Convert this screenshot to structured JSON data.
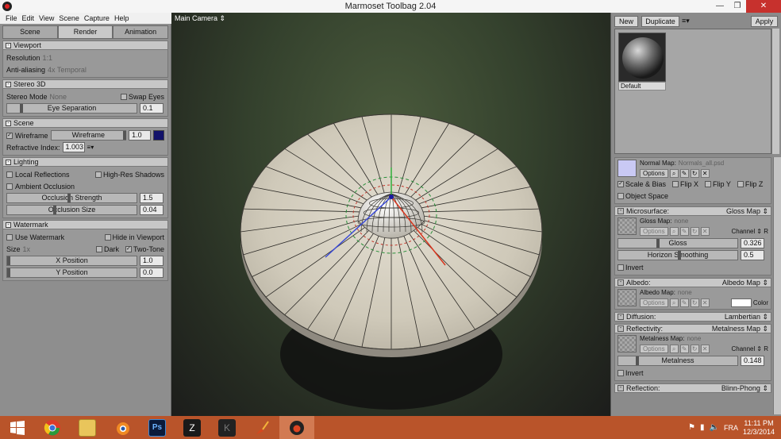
{
  "window": {
    "title": "Marmoset Toolbag 2.04"
  },
  "menu": [
    "File",
    "Edit",
    "View",
    "Scene",
    "Capture",
    "Help"
  ],
  "tabs": [
    "Scene",
    "Render",
    "Animation"
  ],
  "viewport_section": {
    "title": "Viewport",
    "resolution_label": "Resolution",
    "resolution_value": "1:1",
    "aa_label": "Anti-aliasing",
    "aa_value": "4x Temporal"
  },
  "stereo": {
    "title": "Stereo 3D",
    "mode_label": "Stereo Mode",
    "mode_value": "None",
    "swap_label": "Swap Eyes",
    "sep_label": "Eye Separation",
    "sep_value": "0.1"
  },
  "scene": {
    "title": "Scene",
    "wire_label": "Wireframe",
    "wire_slider": "Wireframe",
    "wire_value": "1.0",
    "refr_label": "Refractive Index:",
    "refr_value": "1.003"
  },
  "lighting": {
    "title": "Lighting",
    "local_refl": "Local Reflections",
    "hires": "High-Res Shadows",
    "ao": "Ambient Occlusion",
    "occ_strength": "Occlusion Strength",
    "occ_strength_value": "1.5",
    "occ_size": "Occlusion Size",
    "occ_size_value": "0.04"
  },
  "watermark": {
    "title": "Watermark",
    "use": "Use Watermark",
    "hide": "Hide in Viewport",
    "size_label": "Size",
    "size_value": "1x",
    "dark": "Dark",
    "twotone": "Two-Tone",
    "xpos": "X Position",
    "xpos_value": "1.0",
    "ypos": "Y Position",
    "ypos_value": "0.0"
  },
  "camera": {
    "label": "Main Camera"
  },
  "materials": {
    "new": "New",
    "duplicate": "Duplicate",
    "apply": "Apply",
    "default_name": "Default",
    "normal_map_label": "Normal Map:",
    "normal_map_file": "Normals_all.psd",
    "options": "Options",
    "scale_bias": "Scale & Bias",
    "flip_x": "Flip X",
    "flip_y": "Flip Y",
    "flip_z": "Flip Z",
    "object_space": "Object Space",
    "microsurface": "Microsurface:",
    "microsurface_mode": "Gloss Map",
    "gloss_map_label": "Gloss Map:",
    "gloss_map_value": "none",
    "channel": "Channel",
    "channel_value": "R",
    "gloss": "Gloss",
    "gloss_value": "0.326",
    "horizon": "Horizon Smoothing",
    "horizon_value": "0.5",
    "invert": "Invert",
    "albedo": "Albedo:",
    "albedo_mode": "Albedo Map",
    "albedo_map_label": "Albedo Map:",
    "albedo_map_value": "none",
    "color": "Color",
    "diffusion": "Diffusion:",
    "diffusion_mode": "Lambertian",
    "reflectivity": "Reflectivity:",
    "reflectivity_mode": "Metalness Map",
    "metal_map_label": "Metalness Map:",
    "metal_map_value": "none",
    "metalness": "Metalness",
    "metalness_value": "0.148",
    "reflection": "Reflection:",
    "reflection_mode": "Blinn-Phong"
  },
  "tray": {
    "lang": "FRA",
    "time": "11:11 PM",
    "date": "12/3/2014"
  },
  "colors": {
    "wire_swatch": "#12126a",
    "taskbar": "#b9542a",
    "normal_swatch": "#c9c9f4"
  }
}
